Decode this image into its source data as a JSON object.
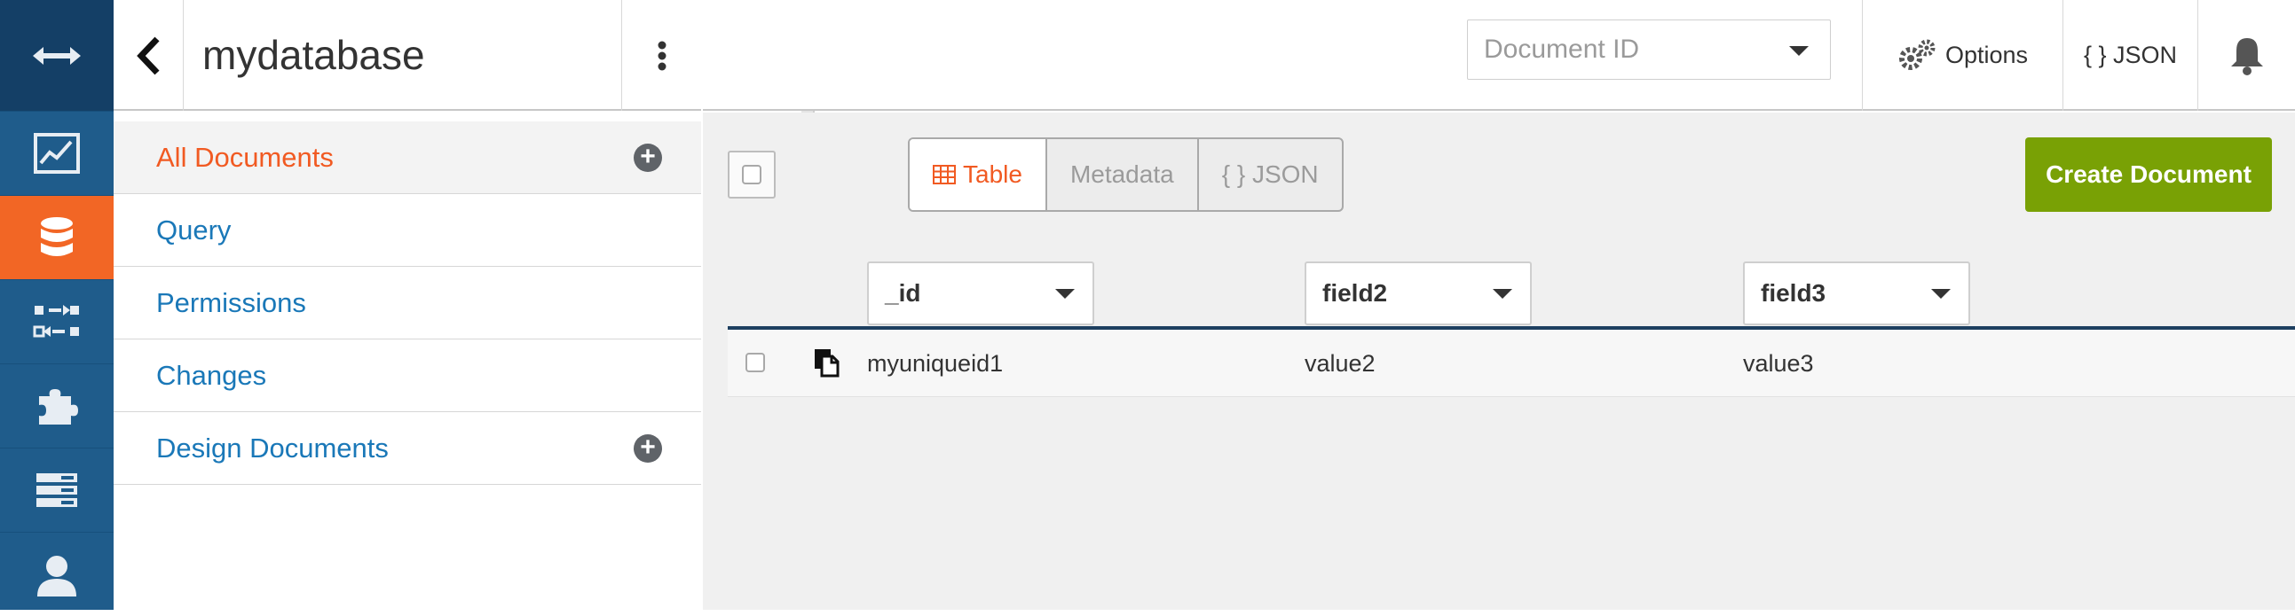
{
  "nav": {
    "items": [
      {
        "icon": "expand-arrows-icon"
      },
      {
        "icon": "activity-chart-icon"
      },
      {
        "icon": "database-icon",
        "active": true
      },
      {
        "icon": "replication-icon"
      },
      {
        "icon": "plugin-puzzle-icon"
      },
      {
        "icon": "server-rack-icon"
      },
      {
        "icon": "user-icon"
      }
    ],
    "accent": "#f26625"
  },
  "sidebar": {
    "db_name": "mydatabase",
    "items": [
      {
        "label": "All Documents",
        "active": true,
        "has_add": true
      },
      {
        "label": "Query"
      },
      {
        "label": "Permissions"
      },
      {
        "label": "Changes"
      },
      {
        "label": "Design Documents",
        "has_add": true
      }
    ]
  },
  "topbar": {
    "doc_id_placeholder": "Document ID",
    "options_label": "Options",
    "json_label": "{ } JSON"
  },
  "toolbar": {
    "view_options": [
      {
        "label": "Table",
        "active": true
      },
      {
        "label": "Metadata"
      },
      {
        "label": "{ } JSON"
      }
    ],
    "create_label": "Create Document",
    "create_color": "#79a105"
  },
  "table": {
    "columns": [
      "_id",
      "field2",
      "field3"
    ],
    "rows": [
      [
        "myuniqueid1",
        "value2",
        "value3"
      ]
    ]
  }
}
